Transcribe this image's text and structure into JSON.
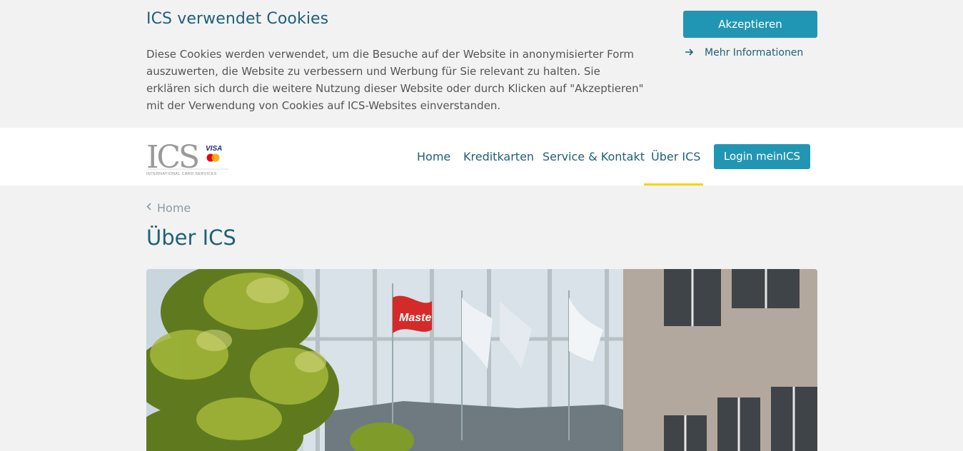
{
  "cookie_banner": {
    "title": "ICS verwendet Cookies",
    "text": "Diese Cookies werden verwendet, um die Besuche auf der Website in anonymisierter Form auszuwerten, die Website zu verbessern und Werbung für Sie relevant zu halten. Sie erklären sich durch die weitere Nutzung dieser Website oder durch Klicken auf \"Akzeptieren\" mit der Verwendung von Cookies auf ICS-Websites einverstanden.",
    "accept_label": "Akzeptieren",
    "more_info_label": "Mehr Informationen",
    "more_info_icon": "arrow-right-icon"
  },
  "header": {
    "logo": {
      "letters": "ICS",
      "visa": "VISA",
      "tagline": "INTERNATIONAL CARD SERVICES"
    },
    "nav": [
      {
        "label": "Home"
      },
      {
        "label": "Kreditkarten"
      },
      {
        "label": "Service & Kontakt"
      },
      {
        "label": "Über ICS",
        "active": true
      }
    ],
    "login_label": "Login meinICS"
  },
  "breadcrumb": {
    "icon": "chevron-left-icon",
    "label": "Home"
  },
  "page": {
    "title": "Über ICS"
  },
  "hero": {
    "flag_text": "Maste"
  },
  "colors": {
    "accent": "#2196b4",
    "heading": "#1f5f7a",
    "active_underline": "#f3d600",
    "background": "#f2f2f2"
  }
}
